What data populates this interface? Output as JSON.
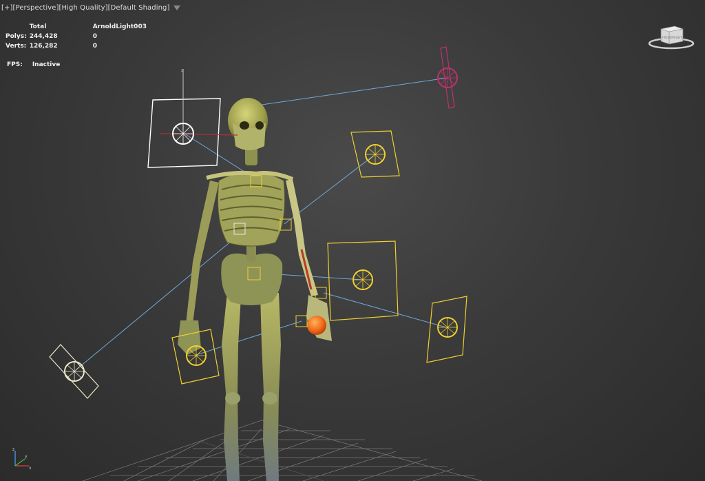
{
  "viewport_menu": {
    "plus": "[+]",
    "view": "[Perspective]",
    "quality": "[High Quality]",
    "shading": "[Default Shading]",
    "filter_icon": "filter-icon"
  },
  "stats": {
    "header_total": "Total",
    "header_selected": "ArnoldLight003",
    "polys_label": "Polys:",
    "polys_total": "244,428",
    "polys_selected": "0",
    "verts_label": "Verts:",
    "verts_total": "126,282",
    "verts_selected": "0"
  },
  "fps": {
    "label": "FPS:",
    "value": "Inactive"
  },
  "viewcube": {
    "front_text": "FRONT",
    "right_text": "RIGHT"
  },
  "axis": {
    "x": "x",
    "y": "y",
    "z": "z"
  },
  "colors": {
    "light_selected": "#ffffff",
    "light_default": "#f0d030",
    "light_pink": "#c0306a",
    "light_cream": "#ece9c8",
    "link_line": "#6fa8dc",
    "bone": "#a9a85a",
    "apple": "#f26a1b",
    "grid": "#8a8a8a"
  }
}
